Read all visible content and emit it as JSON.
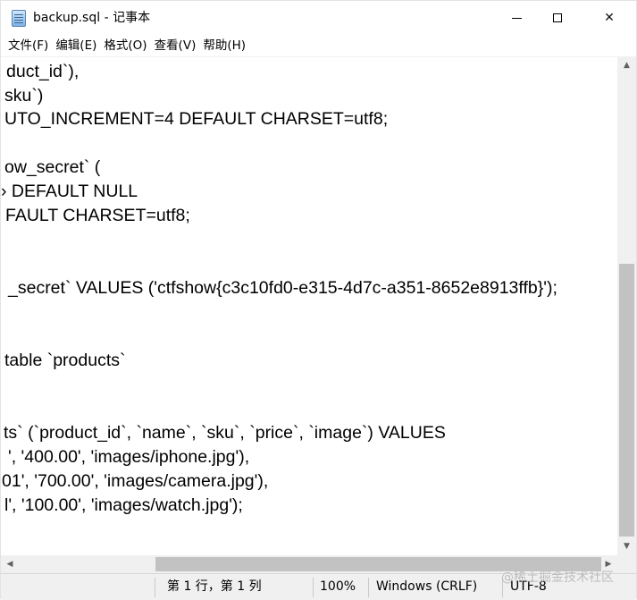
{
  "window": {
    "title": "backup.sql - 记事本",
    "minimize_glyph": "",
    "close_glyph": "✕"
  },
  "menu": {
    "items": [
      "文件(F)",
      "编辑(E)",
      "格式(O)",
      "查看(V)",
      "帮助(H)"
    ]
  },
  "editor": {
    "lines": [
      "duct_id`),",
      "sku`)",
      "UTO_INCREMENT=4 DEFAULT CHARSET=utf8;",
      "",
      "ow_secret` (",
      "› DEFAULT NULL",
      "FAULT CHARSET=utf8;",
      "",
      "",
      "_secret` VALUES ('ctfshow{c3c10fd0-e315-4d7c-a351-8652e8913ffb}');",
      "",
      "",
      "table `products`",
      "",
      "",
      "ts` (`product_id`, `name`, `sku`, `price`, `image`) VALUES",
      "', '400.00', 'images/iphone.jpg'),",
      "01', '700.00', 'images/camera.jpg'),",
      "l', '100.00', 'images/watch.jpg');"
    ]
  },
  "scroll": {
    "up_glyph": "▲",
    "down_glyph": "▼",
    "left_glyph": "◀",
    "right_glyph": "▶"
  },
  "status": {
    "position": "第 1 行，第 1 列",
    "zoom": "100%",
    "line_ending": "Windows (CRLF)",
    "encoding": "UTF-8"
  },
  "watermark": "@稀土掘金技术社区"
}
